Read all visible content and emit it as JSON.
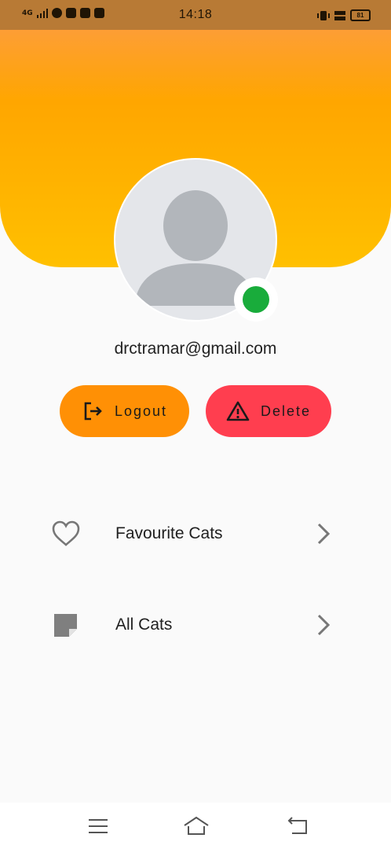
{
  "status_bar": {
    "network": "4G",
    "time": "14:18",
    "battery": "81"
  },
  "profile": {
    "email": "drctramar@gmail.com",
    "online": true
  },
  "actions": {
    "logout_label": "Logout",
    "delete_label": "Delete"
  },
  "menu": {
    "items": [
      {
        "label": "Favourite Cats",
        "icon": "heart-outline-icon"
      },
      {
        "label": "All Cats",
        "icon": "sticky-note-icon"
      }
    ]
  },
  "colors": {
    "header_orange": "#ffa600",
    "header_yellow": "#ffc000",
    "logout_button": "#ff9005",
    "delete_button": "#ff3e4f",
    "online_green": "#19ac3b"
  }
}
